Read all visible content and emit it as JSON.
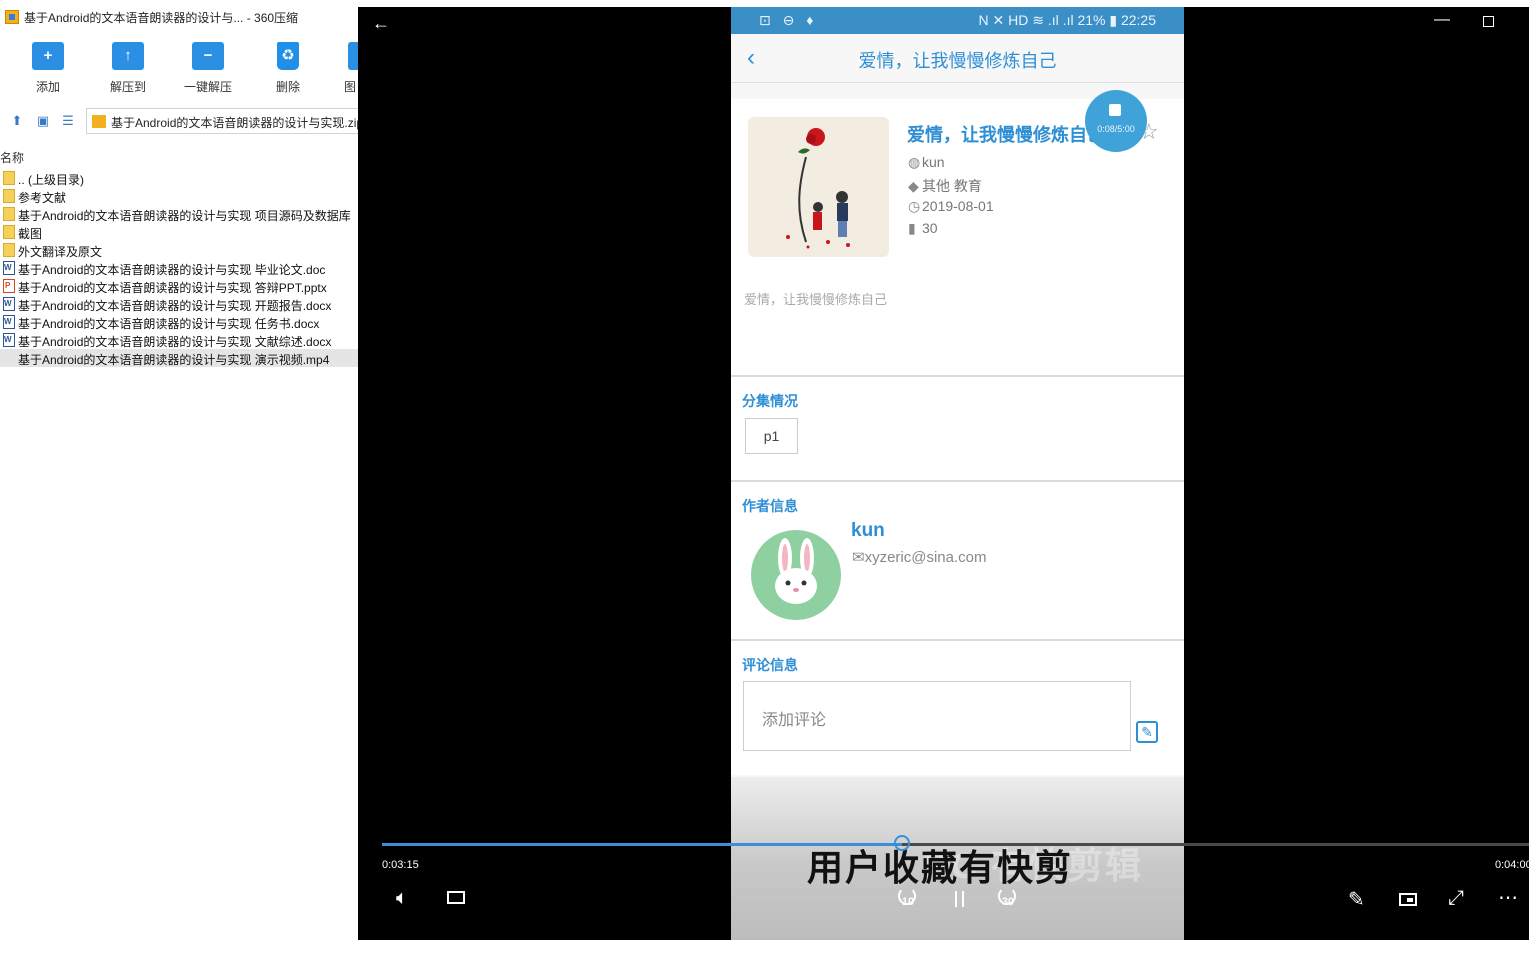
{
  "zip": {
    "title": "基于Android的文本语音朗读器的设计与... - 360压缩",
    "toolbar": [
      {
        "label": "添加",
        "icon": "add-icon",
        "glyph": "+"
      },
      {
        "label": "解压到",
        "icon": "extract-to-icon",
        "glyph": "↑"
      },
      {
        "label": "一键解压",
        "icon": "one-click-extract-icon",
        "glyph": "−"
      },
      {
        "label": "删除",
        "icon": "delete-icon",
        "glyph": "♻"
      },
      {
        "label": "图",
        "icon": "more-icon",
        "glyph": ""
      }
    ],
    "address": "基于Android的文本语音朗读器的设计与实现.zip",
    "column_header": "名称",
    "files": [
      {
        "name": ".. (上级目录)",
        "type": "folder"
      },
      {
        "name": "参考文献",
        "type": "folder"
      },
      {
        "name": "基于Android的文本语音朗读器的设计与实现 项目源码及数据库",
        "type": "folder"
      },
      {
        "name": "截图",
        "type": "folder"
      },
      {
        "name": "外文翻译及原文",
        "type": "folder"
      },
      {
        "name": "基于Android的文本语音朗读器的设计与实现 毕业论文.doc",
        "type": "doc"
      },
      {
        "name": "基于Android的文本语音朗读器的设计与实现 答辩PPT.pptx",
        "type": "ppt"
      },
      {
        "name": "基于Android的文本语音朗读器的设计与实现 开题报告.docx",
        "type": "doc"
      },
      {
        "name": "基于Android的文本语音朗读器的设计与实现 任务书.docx",
        "type": "doc"
      },
      {
        "name": "基于Android的文本语音朗读器的设计与实现 文献综述.docx",
        "type": "doc"
      },
      {
        "name": "基于Android的文本语音朗读器的设计与实现 演示视频.mp4",
        "type": "video",
        "selected": true
      }
    ]
  },
  "phone": {
    "status_left": "⊡ ⊖ ♦",
    "status_right": "N ✕ HD ≋ .ıl .ıl 21% ▮ 22:25",
    "app_title": "爱情，让我慢慢修炼自己",
    "story": {
      "title": "爱情，让我慢慢修炼自己",
      "author": "kun",
      "category": "其他 教育",
      "date": "2019-08-01",
      "plays": "30",
      "description": "爱情，让我慢慢修炼自己"
    },
    "recorder_time": "0:08/5:00",
    "episodes_title": "分集情况",
    "episode_label": "p1",
    "author_section_title": "作者信息",
    "author_name": "kun",
    "author_email": "xyzeric@sina.com",
    "comments_title": "评论信息",
    "comment_placeholder": "添加评论",
    "subtitle": "用户收藏有快剪",
    "subtitle_ghost": "BC 有快剪辑"
  },
  "player": {
    "current_time": "0:03:15",
    "total_time": "0:04:00",
    "progress_fraction": 0.453,
    "accent": "#3a8fd8",
    "skip_back": "10",
    "skip_fwd": "30"
  }
}
